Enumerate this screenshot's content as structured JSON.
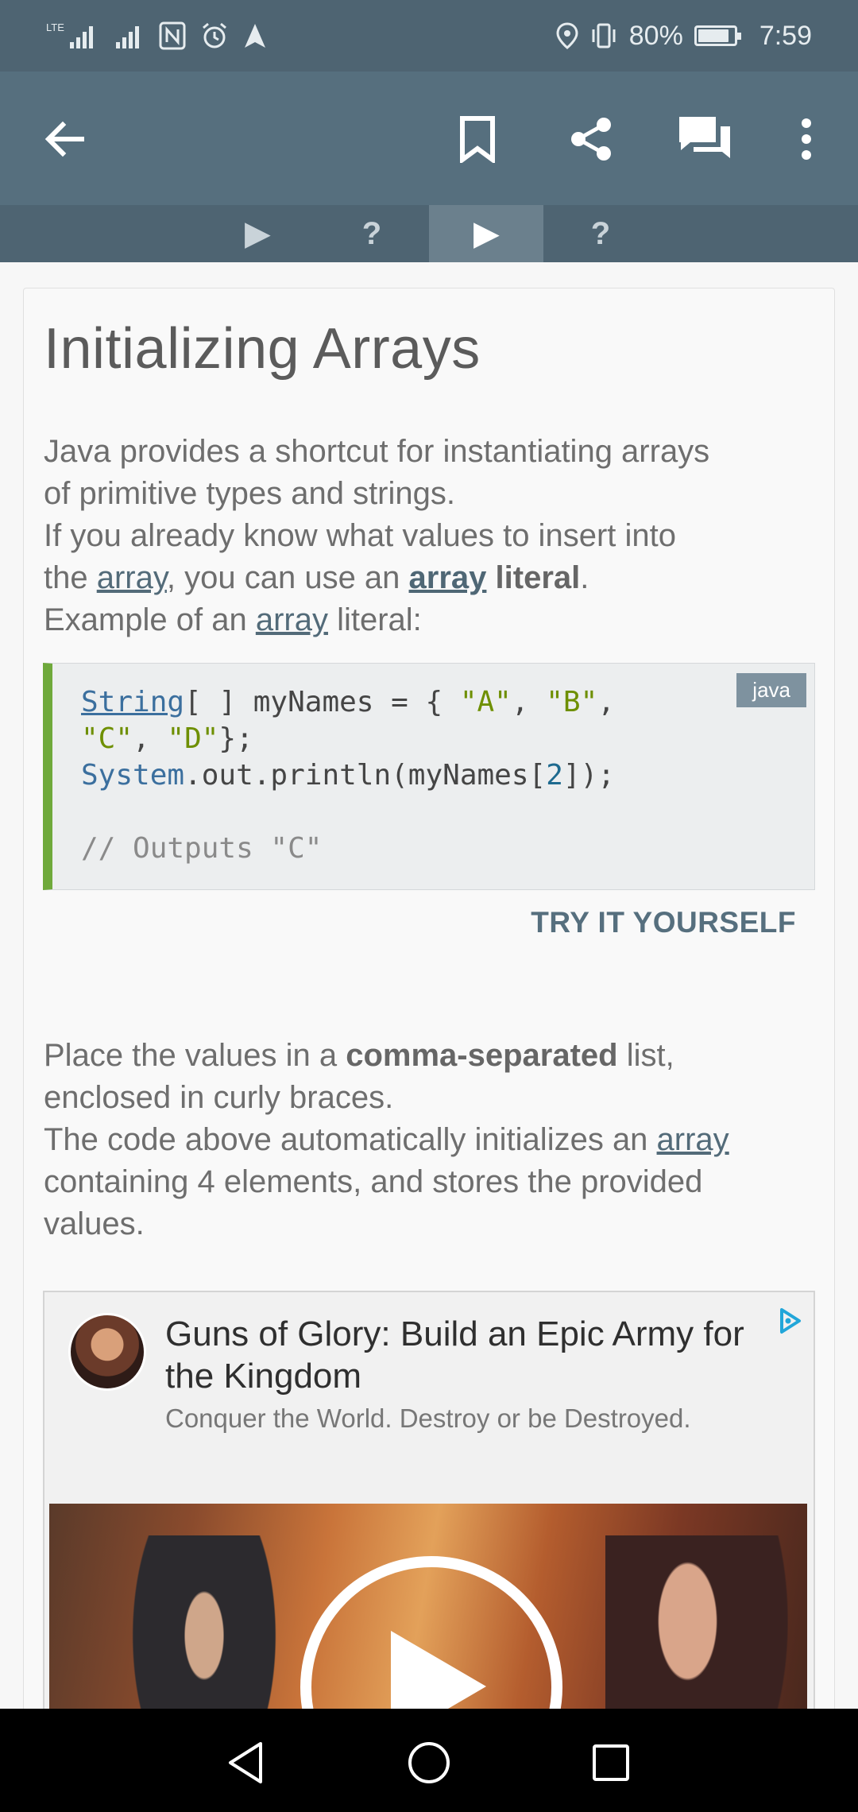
{
  "status_bar": {
    "left_icons": [
      "lte-signal-icon",
      "signal-icon",
      "nfc-icon",
      "alarm-icon",
      "navigation-icon"
    ],
    "lte_label": "LTE",
    "battery_percent": "80%",
    "time": "7:59"
  },
  "app_bar": {
    "back": "back-arrow-icon",
    "bookmark": "bookmark-icon",
    "share": "share-icon",
    "comments": "comments-icon",
    "more": "more-vert-icon"
  },
  "lesson_tabs": [
    {
      "label": "▶",
      "active": false
    },
    {
      "label": "?",
      "active": false
    },
    {
      "label": "▶",
      "active": true
    },
    {
      "label": "?",
      "active": false
    }
  ],
  "lesson": {
    "title": "Initializing Arrays",
    "p1_line1": "Java provides a shortcut for instantiating arrays",
    "p1_line2": "of primitive types and strings.",
    "p1_line3": "If you already know what values to insert into",
    "p1_line4_a": "the ",
    "p1_line4_link": "array",
    "p1_line4_b": ", you can use an ",
    "p1_line4_link2": "array",
    "p1_line4_bold": " literal",
    "p1_line4_c": ".",
    "p1_line5_a": "Example of an ",
    "p1_line5_link": "array",
    "p1_line5_b": " literal:",
    "code_lang": "java",
    "try_label": "TRY IT YOURSELF",
    "p2_line1_a": "Place the values in a ",
    "p2_line1_bold": "comma-separated",
    "p2_line1_b": " list,",
    "p2_line2": "enclosed in curly braces.",
    "p2_line3_a": "The code above automatically initializes an ",
    "p2_line3_link": "array",
    "p2_line4": "containing 4 elements, and stores the provided",
    "p2_line5": "values."
  },
  "code_block": {
    "l1_cls": "String",
    "l1_a": "[ ] myNames = { ",
    "l1_s1": "\"A\"",
    "l1_c1": ", ",
    "l1_s2": "\"B\"",
    "l1_c2": ",",
    "l2_s1": "\"C\"",
    "l2_c1": ", ",
    "l2_s2": "\"D\"",
    "l2_end": "};",
    "l3_cls": "System",
    "l3_a": ".out.println(myNames[",
    "l3_num": "2",
    "l3_b": "]);",
    "l5_cmt": "// Outputs \"C\""
  },
  "ad": {
    "title": "Guns of Glory: Build an Epic Army for the Kingdom",
    "subtitle": "Conquer the World. Destroy or be Destroyed.",
    "choice_icon": "ad-choices-icon",
    "media": "video-thumbnail"
  },
  "nav_bar": {
    "back": "nav-back-icon",
    "home": "nav-home-icon",
    "recents": "nav-recents-icon"
  },
  "colors": {
    "app_bar": "#566f7e",
    "status_bar": "#4e6472",
    "accent_green": "#6fa93b",
    "link": "#536b79"
  }
}
